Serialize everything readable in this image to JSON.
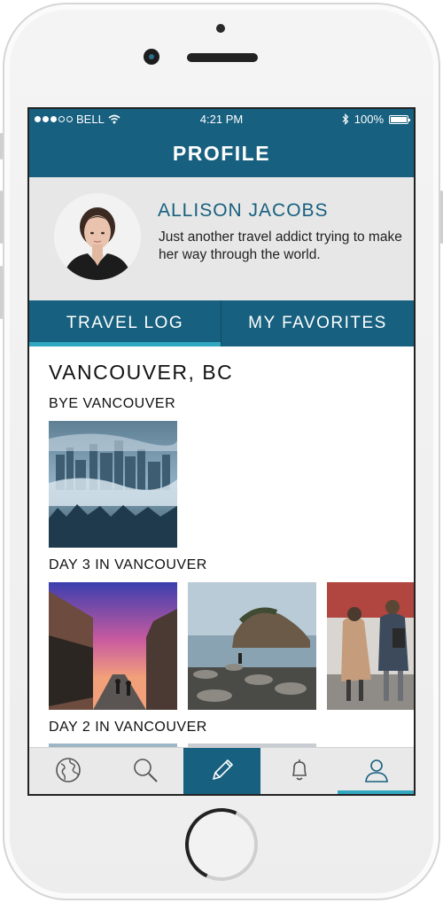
{
  "status_bar": {
    "carrier": "BELL",
    "time": "4:21 PM",
    "battery": "100%",
    "signal_bars": 3
  },
  "header": {
    "title": "PROFILE"
  },
  "profile": {
    "name": "ALLISON JACOBS",
    "bio": "Just another travel addict trying to make her way through the world."
  },
  "tabs": [
    {
      "label": "TRAVEL LOG",
      "active": true
    },
    {
      "label": "MY FAVORITES",
      "active": false
    }
  ],
  "feed": {
    "location": "VANCOUVER, BC",
    "posts": [
      {
        "title": "BYE VANCOUVER"
      },
      {
        "title": "DAY 3 IN VANCOUVER"
      },
      {
        "title": "DAY 2 IN VANCOUVER"
      }
    ]
  },
  "tab_bar": [
    {
      "icon": "globe-icon"
    },
    {
      "icon": "search-icon"
    },
    {
      "icon": "pencil-icon",
      "active": true
    },
    {
      "icon": "bell-icon"
    },
    {
      "icon": "user-icon",
      "selected": true
    }
  ],
  "colors": {
    "primary": "#17607f",
    "accent": "#31a7c0",
    "profile_bg": "#e7e7e7"
  }
}
